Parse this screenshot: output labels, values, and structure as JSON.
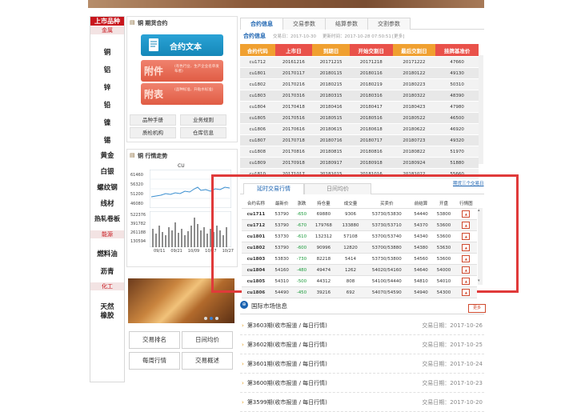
{
  "nav": {
    "heading": "上市品种",
    "groups": [
      {
        "title": "金属",
        "items": [
          "铜",
          "铝",
          "锌",
          "铅",
          "镍",
          "锡",
          "黄金",
          "白银",
          "螺纹钢",
          "线材",
          "热轧卷板"
        ]
      },
      {
        "title": "能源",
        "items": [
          "燃料油",
          "沥青"
        ]
      },
      {
        "title": "化工",
        "items": [
          "天然橡胶"
        ]
      }
    ]
  },
  "contract_panel": {
    "title": "铜 期货合约",
    "btn_contract": "合约文本",
    "btn_attachment_big": "附件",
    "btn_attachment_small": "(有色行业、生产企业名单发布者)",
    "btn_table_big": "附表",
    "btn_table_small": "(品种标准、升贴水标准)",
    "links": [
      "品种手册",
      "业务规则",
      "质检机构",
      "仓库信息"
    ]
  },
  "trend_panel": {
    "title": "铜 行情走势",
    "code": "CU",
    "price_ticks": [
      "61460",
      "56320",
      "51200",
      "46080"
    ],
    "volume_ticks": [
      "522376",
      "391782",
      "261188",
      "130594"
    ],
    "date_ticks": [
      "09/11",
      "09/21",
      "10/09",
      "10/17",
      "10/27"
    ]
  },
  "bottom_buttons": [
    "交易排名",
    "日间均价",
    "每周行情",
    "交易概述"
  ],
  "contract_tabs": [
    "合约信息",
    "交易参数",
    "结算参数",
    "交割参数"
  ],
  "contract_info": {
    "label": "合约信息",
    "exchange_date": "交易日：2017-10-30",
    "update_time": "更新时间：2017-10-28 07:50:51",
    "more": "[更多]"
  },
  "contract_table": {
    "headers": [
      "合约代码",
      "上市日",
      "到期日",
      "开始交割日",
      "最后交割日",
      "挂牌基准价"
    ],
    "rows": [
      [
        "cu1712",
        "20161216",
        "20171215",
        "20171218",
        "20171222",
        "47660"
      ],
      [
        "cu1801",
        "20170117",
        "20180115",
        "20180116",
        "20180122",
        "49130"
      ],
      [
        "cu1802",
        "20170216",
        "20180215",
        "20180219",
        "20180223",
        "50310"
      ],
      [
        "cu1803",
        "20170316",
        "20180315",
        "20180316",
        "20180322",
        "48390"
      ],
      [
        "cu1804",
        "20170418",
        "20180416",
        "20180417",
        "20180423",
        "47980"
      ],
      [
        "cu1805",
        "20170516",
        "20180515",
        "20180516",
        "20180522",
        "46500"
      ],
      [
        "cu1806",
        "20170616",
        "20180615",
        "20180618",
        "20180622",
        "46920"
      ],
      [
        "cu1807",
        "20170718",
        "20180716",
        "20180717",
        "20180723",
        "49320"
      ],
      [
        "cu1808",
        "20170816",
        "20180815",
        "20180816",
        "20180822",
        "51970"
      ],
      [
        "cu1809",
        "20170918",
        "20180917",
        "20180918",
        "20180924",
        "51880"
      ],
      [
        "cu1810",
        "20171017",
        "20181015",
        "20181016",
        "20181022",
        "55660"
      ]
    ]
  },
  "quote_tabs": [
    "延时交易行情",
    "日间均价"
  ],
  "quote_more": "期货三个交易日",
  "quote_table": {
    "headers": [
      "合约名称",
      "最新价",
      "涨跌",
      "持仓量",
      "成交量",
      "买卖价",
      "前结算",
      "开盘",
      "行情图"
    ],
    "rows": [
      [
        "cu1711",
        "53790",
        "-650",
        "69880",
        "9306",
        "53730/53830",
        "54440",
        "53800"
      ],
      [
        "cu1712",
        "53790",
        "-670",
        "179768",
        "133880",
        "53730/53710",
        "54370",
        "53600"
      ],
      [
        "cu1801",
        "53730",
        "-610",
        "132312",
        "57108",
        "53700/53740",
        "54340",
        "53600"
      ],
      [
        "cu1802",
        "53790",
        "-600",
        "90996",
        "12820",
        "53700/53880",
        "54380",
        "53630"
      ],
      [
        "cu1803",
        "53830",
        "-730",
        "82218",
        "5414",
        "53730/53800",
        "54560",
        "53600"
      ],
      [
        "cu1804",
        "54160",
        "-480",
        "49474",
        "1262",
        "54020/54160",
        "54640",
        "54000"
      ],
      [
        "cu1805",
        "54310",
        "-500",
        "44312",
        "808",
        "54100/54440",
        "54810",
        "54010"
      ],
      [
        "cu1806",
        "54490",
        "-450",
        "39216",
        "692",
        "54070/54590",
        "54940",
        "54300"
      ]
    ]
  },
  "news": {
    "title": "国际市场信息",
    "more": "更多",
    "items": [
      {
        "title": "第3603期(收市报道 / 每日行情)",
        "date": "交易日期：2017-10-26"
      },
      {
        "title": "第3602期(收市报道 / 每日行情)",
        "date": "交易日期：2017-10-25"
      },
      {
        "title": "第3601期(收市报道 / 每日行情)",
        "date": "交易日期：2017-10-24"
      },
      {
        "title": "第3600期(收市报道 / 每日行情)",
        "date": "交易日期：2017-10-23"
      },
      {
        "title": "第3599期(收市报道 / 每日行情)",
        "date": "交易日期：2017-10-20"
      }
    ]
  },
  "colors": {
    "brand_red": "#c8161d",
    "accent_blue": "#1a62b0",
    "highlight_red": "#e03a3a",
    "header_orange": "#f0a030"
  }
}
